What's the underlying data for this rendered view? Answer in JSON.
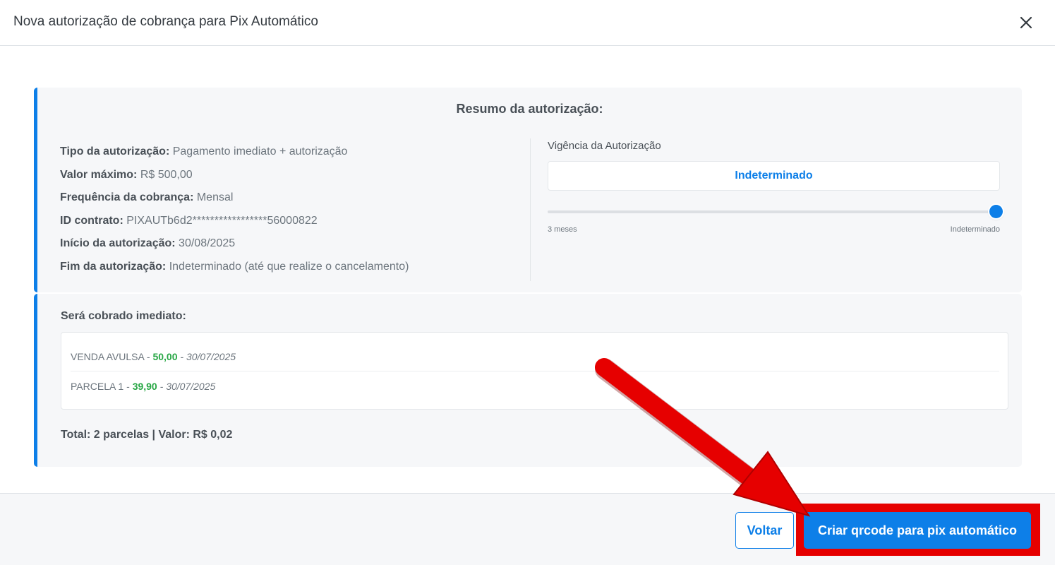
{
  "modal": {
    "title": "Nova autorização de cobrança para Pix Automático"
  },
  "summary": {
    "title": "Resumo da autorização:",
    "items": [
      {
        "label": "Tipo da autorização:",
        "value": "Pagamento imediato + autorização"
      },
      {
        "label": "Valor máximo:",
        "value": "R$ 500,00"
      },
      {
        "label": "Frequência da cobrança:",
        "value": "Mensal"
      },
      {
        "label": "ID contrato:",
        "value": "PIXAUTb6d2*****************56000822"
      },
      {
        "label": "Início da autorização:",
        "value": "30/08/2025"
      },
      {
        "label": "Fim da autorização:",
        "value": "Indeterminado (até que realize o cancelamento)"
      }
    ],
    "vigencia": {
      "label": "Vigência da Autorização",
      "value": "Indeterminado",
      "min_label": "3 meses",
      "max_label": "Indeterminado",
      "slider_fraction": 1.0
    }
  },
  "charges": {
    "title": "Será cobrado imediato:",
    "items": [
      {
        "name": "VENDA AVULSA",
        "sep1": " - ",
        "amount": "50,00",
        "sep2": " - ",
        "date": "30/07/2025"
      },
      {
        "name": "PARCELA 1",
        "sep1": " - ",
        "amount": "39,90",
        "sep2": " - ",
        "date": "30/07/2025"
      }
    ],
    "total": "Total: 2 parcelas | Valor: R$ 0,02"
  },
  "footer": {
    "back_label": "Voltar",
    "create_label": "Criar qrcode para pix automático"
  },
  "colors": {
    "primary": "#0d7fe8",
    "amount_green": "#28a745",
    "annotation_red": "#e60000"
  }
}
